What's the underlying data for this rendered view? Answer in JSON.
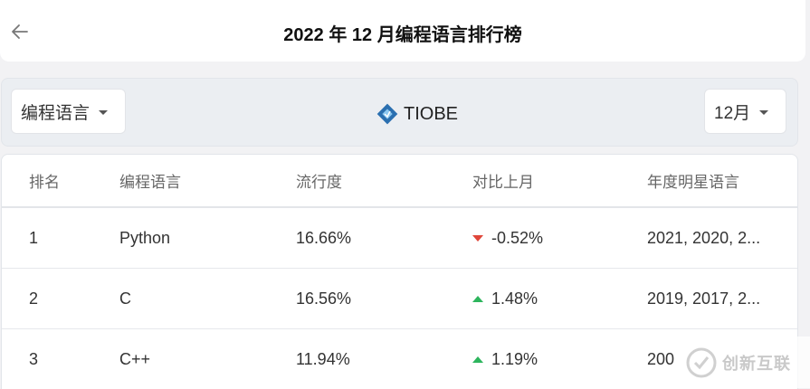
{
  "header": {
    "title": "2022 年 12 月编程语言排行榜",
    "back_icon": "arrow-left-icon"
  },
  "filters": {
    "language_select": "编程语言",
    "brand": "TIOBE",
    "month_select": "12月"
  },
  "table": {
    "columns": [
      "排名",
      "编程语言",
      "流行度",
      "对比上月",
      "年度明星语言"
    ],
    "rows": [
      {
        "rank": "1",
        "language": "Python",
        "popularity": "16.66%",
        "change": "-0.52%",
        "trend": "down",
        "stars": "2021, 2020, 2..."
      },
      {
        "rank": "2",
        "language": "C",
        "popularity": "16.56%",
        "change": "1.48%",
        "trend": "up",
        "stars": "2019, 2017, 2..."
      },
      {
        "rank": "3",
        "language": "C++",
        "popularity": "11.94%",
        "change": "1.19%",
        "trend": "up",
        "stars": "200"
      }
    ]
  },
  "watermark": {
    "text": "创新互联"
  },
  "colors": {
    "down": "#e0463a",
    "up": "#2db55d",
    "brand_icon": "#2a6fb0"
  }
}
